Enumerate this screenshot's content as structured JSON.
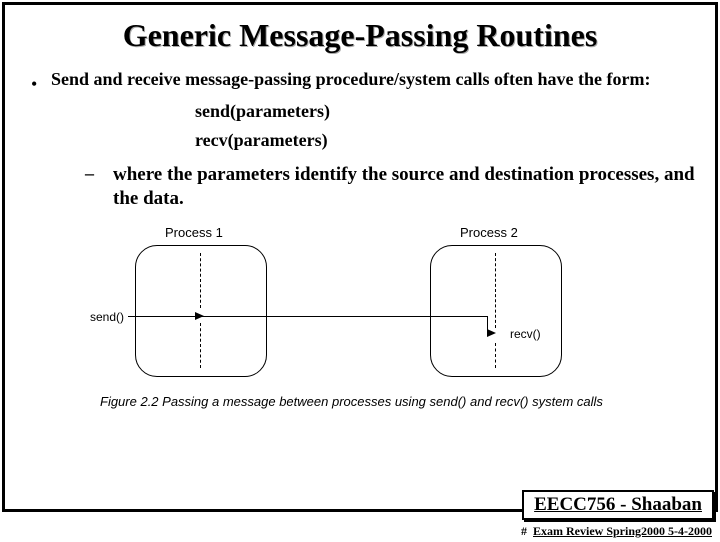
{
  "title": "Generic Message-Passing Routines",
  "bullet1": "Send and receive message-passing procedure/system calls often have the form:",
  "call1": "send(parameters)",
  "call2": "recv(parameters)",
  "sub1": "where the parameters identify the source and destination processes, and the data.",
  "diagram": {
    "proc1": "Process 1",
    "proc2": "Process 2",
    "send": "send()",
    "recv": "recv()"
  },
  "caption": "Figure 2.2 Passing a message between processes using send() and recv() system calls",
  "course": "EECC756 - Shaaban",
  "footer_hash": "#",
  "footer_text": "Exam Review  Spring2000  5-4-2000"
}
